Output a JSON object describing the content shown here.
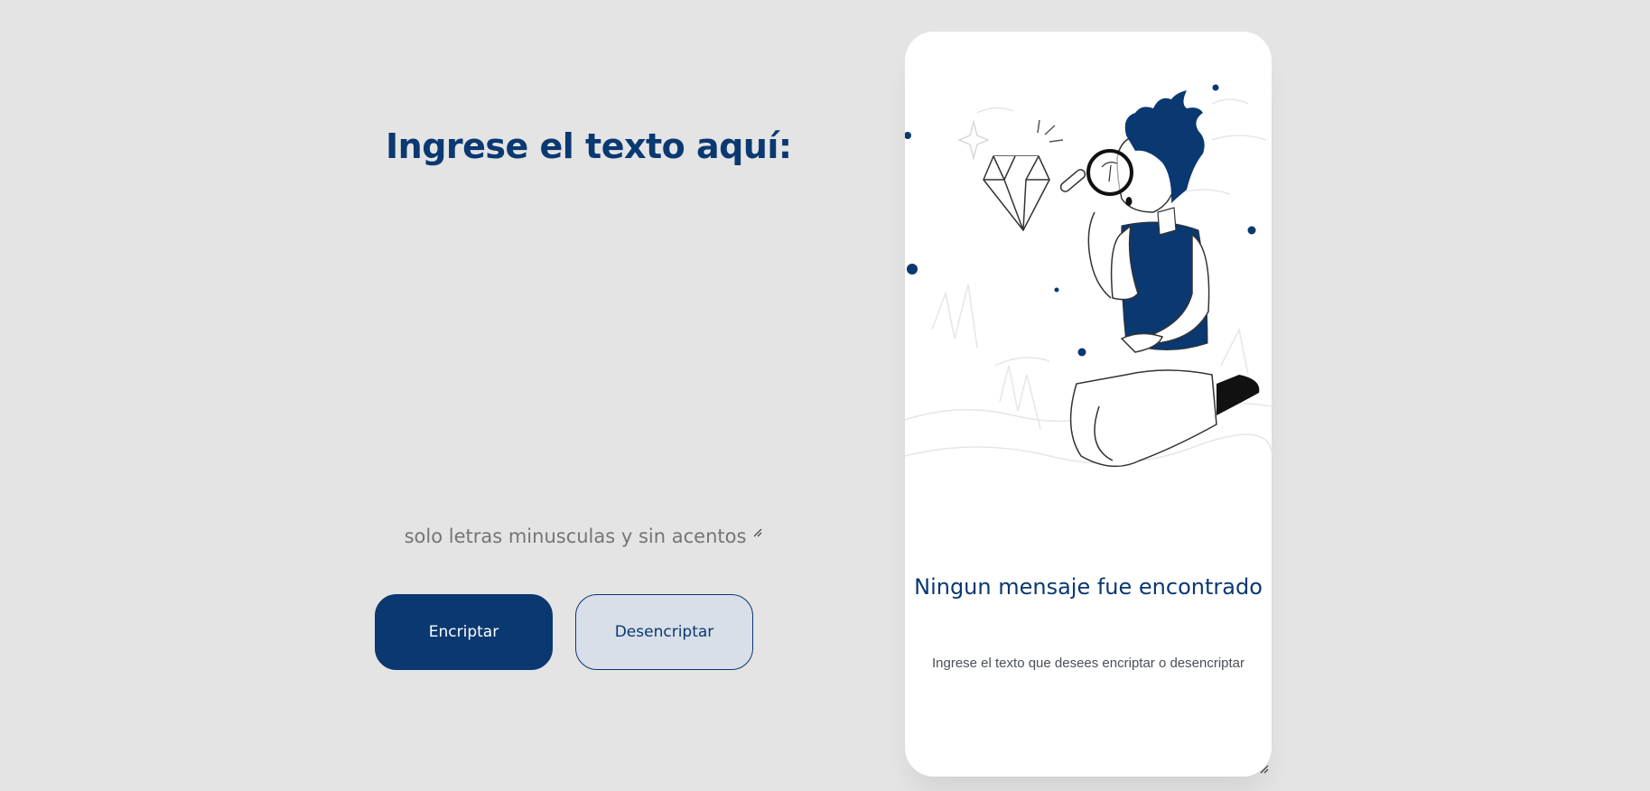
{
  "input": {
    "heading": "Ingrese el texto aquí:",
    "placeholder": "solo letras minusculas y sin acentos",
    "value": ""
  },
  "buttons": {
    "encrypt_label": "Encriptar",
    "decrypt_label": "Desencriptar"
  },
  "result": {
    "title": "Ningun mensaje fue encontrado",
    "subtitle": "Ingrese el texto que desees encriptar o desencriptar",
    "illustration_icon": "person-with-magnifying-glass-illustration"
  },
  "colors": {
    "background": "#e4e4e4",
    "primary": "#0a3871",
    "secondary_button": "#d8dfe8",
    "card": "#ffffff",
    "muted_text": "#495057"
  }
}
